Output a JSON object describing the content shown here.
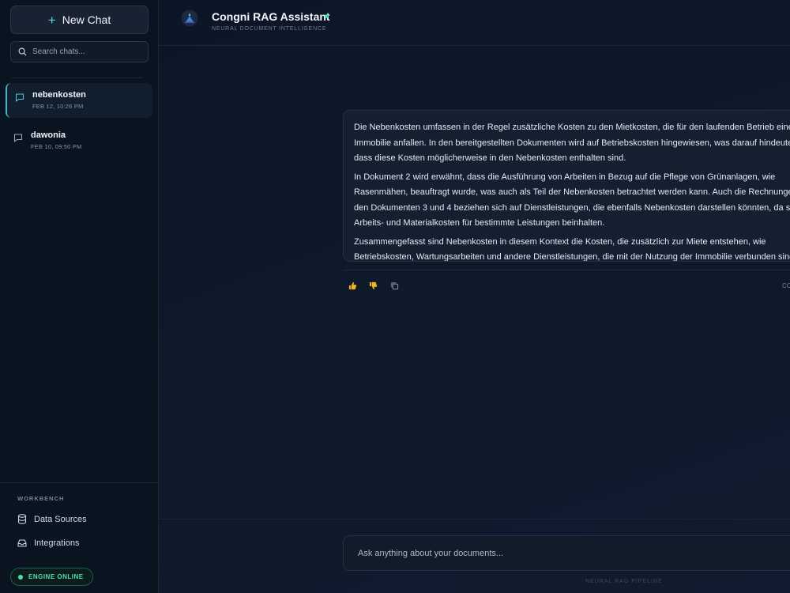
{
  "sidebar": {
    "new_chat_label": "New Chat",
    "search_placeholder": "Search chats...",
    "chats": [
      {
        "title": "nebenkosten",
        "date": "FEB 12, 10:26 PM",
        "active": true
      },
      {
        "title": "dawonia",
        "date": "FEB 10, 09:50 PM",
        "active": false
      }
    ],
    "workbench_label": "WORKBENCH",
    "workbench_items": [
      {
        "label": "Data Sources",
        "icon": "database-icon"
      },
      {
        "label": "Integrations",
        "icon": "inbox-icon"
      }
    ],
    "engine_status": "ENGINE ONLINE"
  },
  "header": {
    "title": "Congni RAG Assistant",
    "subtitle": "NEURAL DOCUMENT INTELLIGENCE"
  },
  "message": {
    "paragraphs": [
      [
        "Die Nebenkosten umfassen in der Regel zusätzliche Kosten zu den Mietkosten, die für den laufenden Betrieb einer",
        "Immobilie anfallen. In den bereitgestellten Dokumenten wird auf Betriebskosten hingewiesen, was darauf hindeutet",
        "dass diese Kosten möglicherweise in den Nebenkosten enthalten sind."
      ],
      [
        "In Dokument 2 wird erwähnt, dass die Ausführung von Arbeiten in Bezug auf die Pflege von Grünanlagen, wie",
        "Rasenmähen, beauftragt wurde, was auch als Teil der Nebenkosten betrachtet werden kann. Auch die Rechnungen",
        "den Dokumenten 3 und 4 beziehen sich auf Dienstleistungen, die ebenfalls Nebenkosten darstellen könnten, da sie",
        "Arbeits- und Materialkosten für bestimmte Leistungen beinhalten."
      ],
      [
        "Zusammengefasst sind Nebenkosten in diesem Kontext die Kosten, die zusätzlich zur Miete entstehen, wie",
        "Betriebskosten, Wartungsarbeiten und andere Dienstleistungen, die mit der Nutzung der Immobilie verbunden sind"
      ]
    ],
    "truncated_label": "CC"
  },
  "composer": {
    "placeholder": "Ask anything about your documents...",
    "footer": "NEURAL RAG PIPELINE"
  },
  "colors": {
    "accent": "#3fb7cc",
    "online": "#4fe0a9",
    "thumbs": "#f2b424"
  }
}
